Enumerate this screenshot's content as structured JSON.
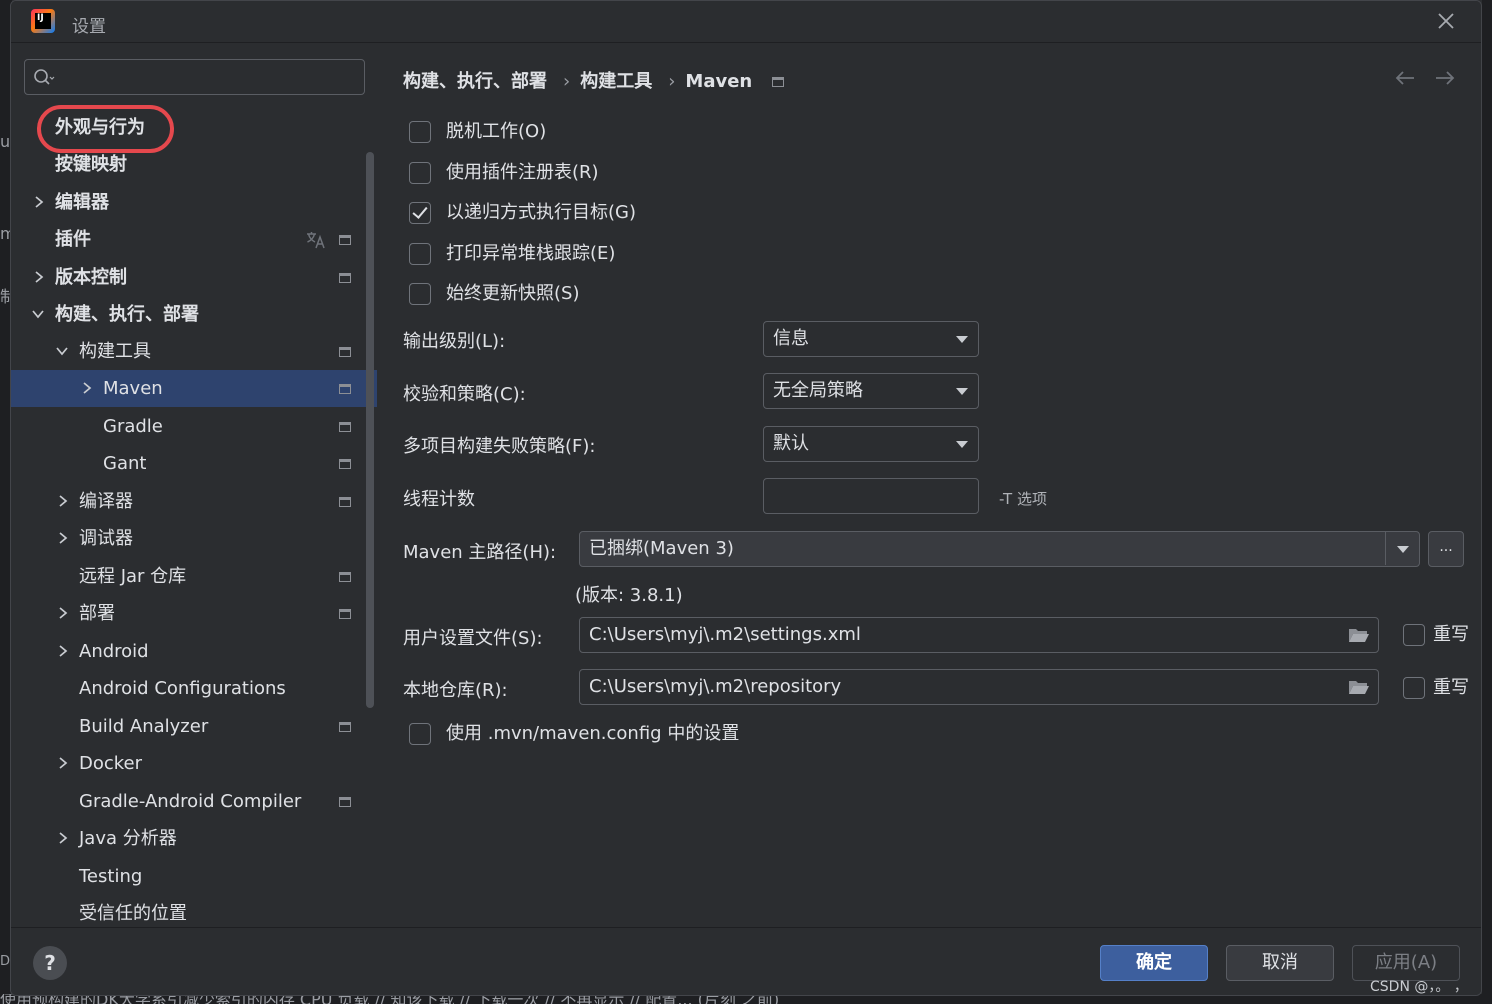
{
  "window": {
    "title": "设置"
  },
  "search": {
    "placeholder": ""
  },
  "sidebar": {
    "items": [
      {
        "label": "外观与行为",
        "bold": true
      },
      {
        "label": "按键映射",
        "bold": true
      },
      {
        "label": "编辑器",
        "bold": true
      },
      {
        "label": "插件",
        "bold": true
      },
      {
        "label": "版本控制",
        "bold": true
      },
      {
        "label": "构建、执行、部署",
        "bold": true
      },
      {
        "label": "构建工具"
      },
      {
        "label": "Maven",
        "selected": true
      },
      {
        "label": "Gradle"
      },
      {
        "label": "Gant"
      },
      {
        "label": "编译器"
      },
      {
        "label": "调试器"
      },
      {
        "label": "远程 Jar 仓库"
      },
      {
        "label": "部署"
      },
      {
        "label": "Android"
      },
      {
        "label": "Android Configurations"
      },
      {
        "label": "Build Analyzer"
      },
      {
        "label": "Docker"
      },
      {
        "label": "Gradle-Android Compiler"
      },
      {
        "label": "Java 分析器"
      },
      {
        "label": "Testing"
      },
      {
        "label": "受信任的位置"
      }
    ]
  },
  "breadcrumb": {
    "part1": "构建、执行、部署",
    "part2": "构建工具",
    "part3": "Maven",
    "sep": "›"
  },
  "options": {
    "offline": {
      "label": "脱机工作(O)",
      "checked": false
    },
    "plugin_registry": {
      "label": "使用插件注册表(R)",
      "checked": false
    },
    "recursive": {
      "label": "以递归方式执行目标(G)",
      "checked": true
    },
    "print_stacktrace": {
      "label": "打印异常堆栈跟踪(E)",
      "checked": false
    },
    "always_update": {
      "label": "始终更新快照(S)",
      "checked": false
    },
    "use_mvn_config": {
      "label": "使用 .mvn/maven.config 中的设置",
      "checked": false
    }
  },
  "fields": {
    "output_level": {
      "label": "输出级别(L):",
      "value": "信息"
    },
    "checksum_policy": {
      "label": "校验和策略(C):",
      "value": "无全局策略"
    },
    "fail_policy": {
      "label": "多项目构建失败策略(F):",
      "value": "默认"
    },
    "thread_count": {
      "label": "线程计数",
      "value": "",
      "hint": "-T 选项"
    },
    "maven_home": {
      "label": "Maven 主路径(H):",
      "value": "已捆绑(Maven 3)",
      "browse": "...",
      "version": "(版本: 3.8.1)"
    },
    "user_settings": {
      "label": "用户设置文件(S):",
      "value": "C:\\Users\\myj\\.m2\\settings.xml",
      "override_label": "重写"
    },
    "local_repo": {
      "label": "本地仓库(R):",
      "value": "C:\\Users\\myj\\.m2\\repository",
      "override_label": "重写"
    }
  },
  "footer": {
    "help": "?",
    "ok": "确定",
    "cancel": "取消",
    "apply": "应用(A)"
  },
  "watermark": "CSDN @，。 ，",
  "backdrop": {
    "left_chars": [
      "u",
      "m",
      "制",
      "DI"
    ],
    "bottom_text": "使用预构建的DK大学系引减少索引的内存 CPU 负载 // 知该下载 // 下载一次 // 不再显示 // 配置... (片刻 之前)"
  },
  "colors": {
    "accent": "#3574f0",
    "selection": "#2e436e",
    "highlight_ring": "#e5484d",
    "background": "#2b2d30"
  }
}
